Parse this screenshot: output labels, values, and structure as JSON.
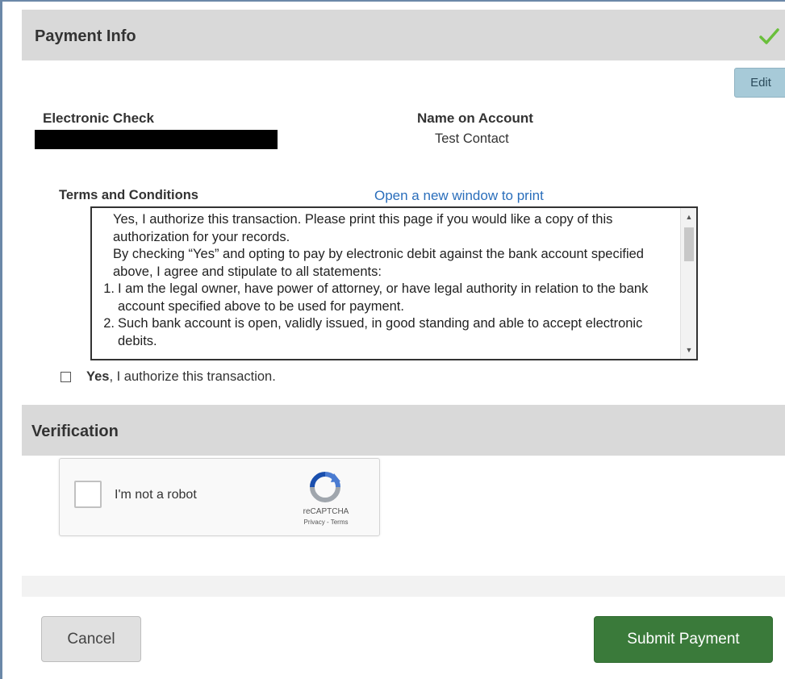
{
  "payment_info": {
    "title": "Payment Info",
    "complete_icon": "checkmark-icon",
    "edit_label": "Edit"
  },
  "account": {
    "method_label": "Electronic Check",
    "name_label": "Name on Account",
    "name_value": "Test Contact"
  },
  "terms": {
    "heading": "Terms and Conditions",
    "print_link": "Open a new window to print",
    "paragraph_1": "Yes, I authorize this transaction. Please print this page if you would like a copy of this authorization for your records.",
    "paragraph_2": "By checking “Yes” and opting to pay by electronic debit against the bank account specified above, I agree and stipulate to all statements:",
    "items": [
      {
        "num": "1.",
        "text": "I am the legal owner, have power of attorney, or have legal authority in relation to the bank account specified above to be used for payment."
      },
      {
        "num": "2.",
        "text": "Such bank account is open, validly issued, in good standing and able to accept electronic debits."
      }
    ],
    "authorize_bold": "Yes",
    "authorize_rest": ", I authorize this transaction."
  },
  "verification": {
    "title": "Verification",
    "captcha_label": "I'm not a robot",
    "captcha_brand": "reCAPTCHA",
    "captcha_links": "Privacy - Terms"
  },
  "actions": {
    "cancel_label": "Cancel",
    "submit_label": "Submit Payment"
  },
  "colors": {
    "submit_bg": "#3a7a3a",
    "link": "#2a6ebb",
    "header_bg": "#d9d9d9",
    "check": "#6abf3b"
  }
}
